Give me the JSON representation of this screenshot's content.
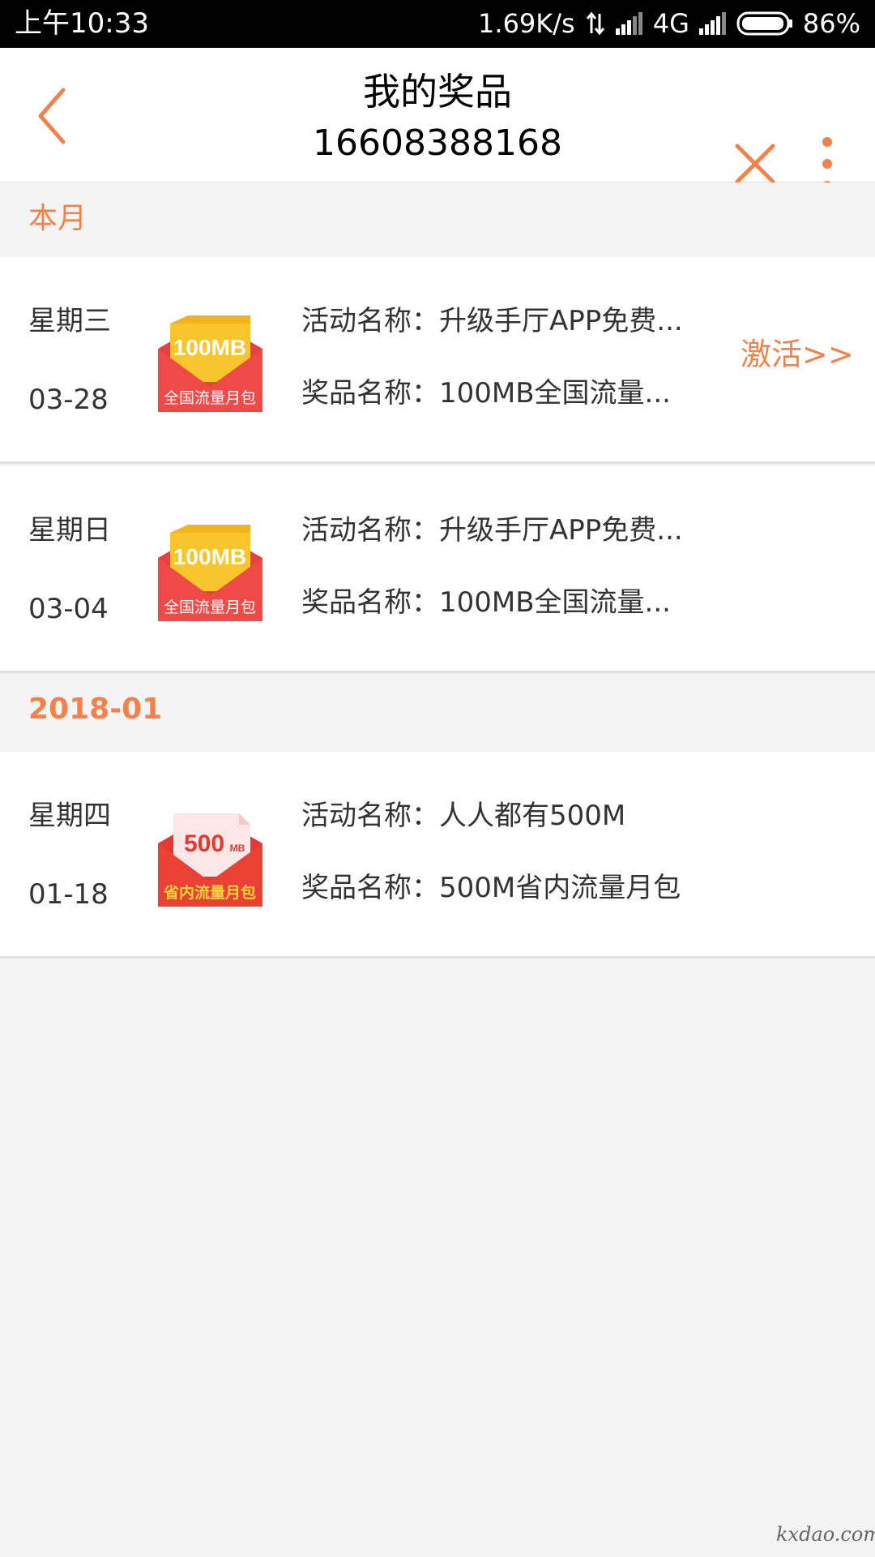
{
  "status_bar": {
    "time": "上午10:33",
    "net_speed": "1.69K/s",
    "network_type": "4G",
    "battery": "86%"
  },
  "nav": {
    "title": "我的奖品",
    "subtitle": "16608388168",
    "icons": {
      "back": "chevron-left-icon",
      "close": "close-icon",
      "more": "more-vertical-icon"
    },
    "accent_color": "#f2824b"
  },
  "sections": [
    {
      "title": "本月",
      "items": [
        {
          "weekday": "星期三",
          "date": "03-28",
          "image": {
            "amount": "100MB",
            "caption": "全国流量月包"
          },
          "activity": "活动名称：升级手厅APP免费...",
          "prize": "奖品名称：100MB全国流量...",
          "action": "激活>>"
        },
        {
          "weekday": "星期日",
          "date": "03-04",
          "image": {
            "amount": "100MB",
            "caption": "全国流量月包"
          },
          "activity": "活动名称：升级手厅APP免费...",
          "prize": "奖品名称：100MB全国流量..."
        }
      ]
    },
    {
      "title": "2018-01",
      "items": [
        {
          "weekday": "星期四",
          "date": "01-18",
          "image": {
            "amount": "500",
            "unit": "MB",
            "caption": "省内流量月包"
          },
          "activity": "活动名称：人人都有500M",
          "prize": "奖品名称：500M省内流量月包"
        }
      ]
    }
  ],
  "watermark": "kxdao.com"
}
